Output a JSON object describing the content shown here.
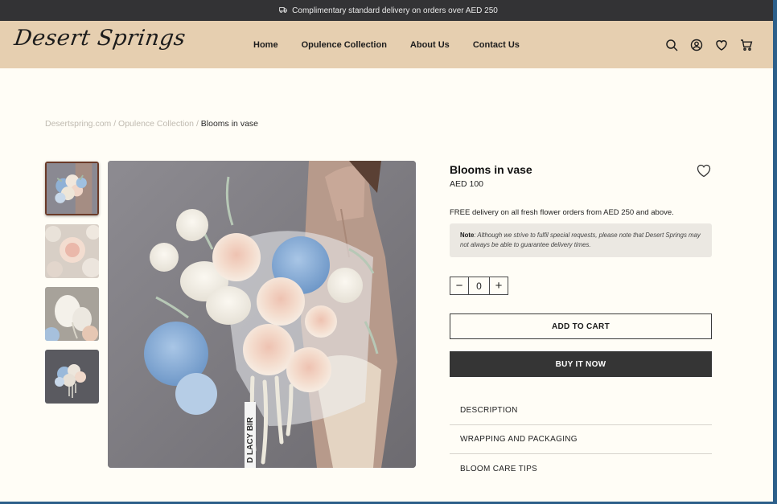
{
  "announcement": {
    "icon": "delivery-truck-icon",
    "text": "Complimentary standard delivery on orders over AED 250"
  },
  "header": {
    "logo_text": "Desert Springs",
    "nav": [
      {
        "label": "Home"
      },
      {
        "label": "Opulence Collection"
      },
      {
        "label": "About Us"
      },
      {
        "label": "Contact Us"
      }
    ],
    "icons": [
      "search-icon",
      "account-icon",
      "wishlist-heart-icon",
      "cart-icon"
    ]
  },
  "breadcrumb": {
    "home": "Desertspring.com",
    "separator_1": " / ",
    "collection": "Opulence Collection",
    "separator_2": " / ",
    "current": "Blooms in vase"
  },
  "gallery": {
    "thumbnails_count": 4,
    "active_index": 0
  },
  "product": {
    "title": "Blooms in vase",
    "price": "AED 100",
    "free_delivery": "FREE delivery on all fresh flower orders from AED 250 and above.",
    "note_label": "Note",
    "note_text": ": Although we strive to fulfil special requests, please note that Desert Springs may not always be able to guarantee delivery times.",
    "quantity": "0",
    "minus": "−",
    "plus": "+",
    "add_to_cart": "ADD TO CART",
    "buy_now": "BUY IT NOW",
    "accordion": [
      {
        "label": "DESCRIPTION"
      },
      {
        "label": "WRAPPING AND PACKAGING"
      },
      {
        "label": "BLOOM CARE TIPS"
      }
    ]
  },
  "colors": {
    "announcement_bg": "#333335",
    "header_bg": "#e6cfb0",
    "page_bg": "#fffdf6",
    "buy_now_bg": "#353535",
    "note_bg": "#ebe8e2"
  }
}
